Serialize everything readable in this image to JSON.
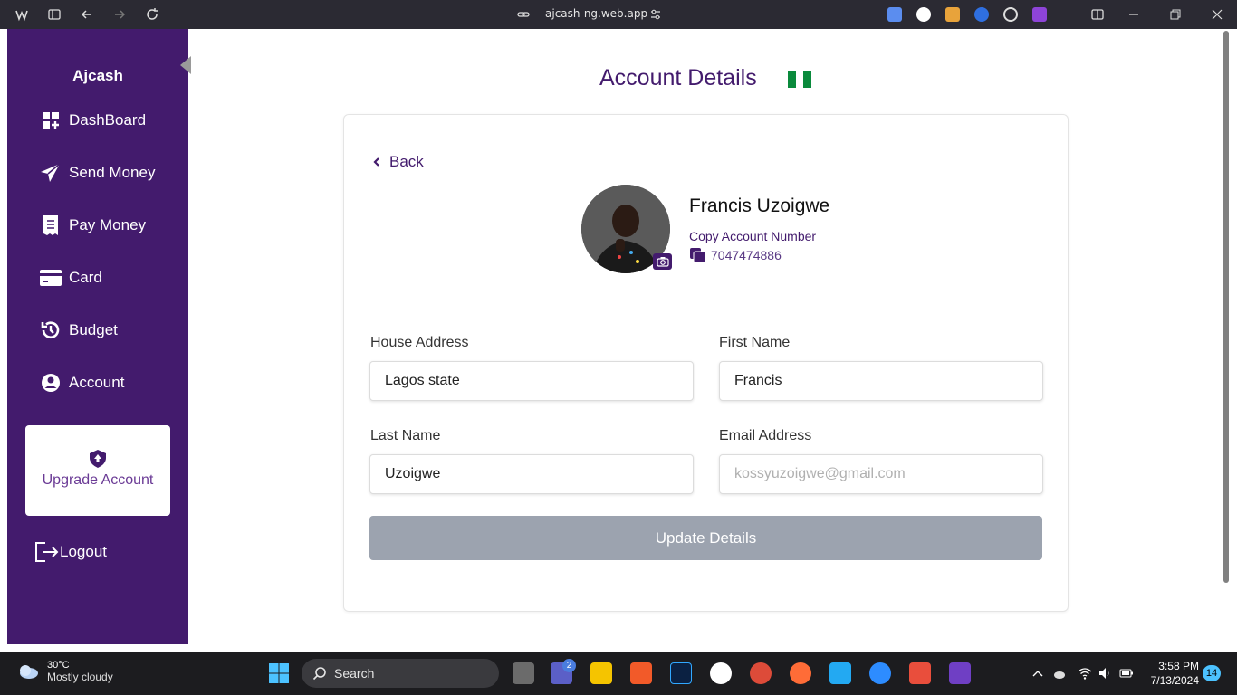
{
  "browser": {
    "url": "ajcash-ng.web.app"
  },
  "sidebar": {
    "brand": "Ajcash",
    "items": [
      {
        "label": "DashBoard",
        "icon": "dashboard-icon"
      },
      {
        "label": "Send Money",
        "icon": "paper-plane-icon"
      },
      {
        "label": "Pay Money",
        "icon": "receipt-icon"
      },
      {
        "label": "Card",
        "icon": "credit-card-icon"
      },
      {
        "label": "Budget",
        "icon": "history-icon"
      },
      {
        "label": "Account",
        "icon": "user-circle-icon"
      }
    ],
    "upgrade_label": "Upgrade Account",
    "logout_label": "Logout"
  },
  "main": {
    "title": "Account Details",
    "back_label": "Back",
    "profile": {
      "name": "Francis Uzoigwe",
      "copy_label": "Copy Account Number",
      "account_number": "7047474886"
    },
    "form": {
      "house_address_label": "House Address",
      "house_address_value": "Lagos state",
      "first_name_label": "First Name",
      "first_name_value": "Francis",
      "last_name_label": "Last Name",
      "last_name_value": "Uzoigwe",
      "email_label": "Email Address",
      "email_placeholder": "kossyuzoigwe@gmail.com",
      "submit_label": "Update Details"
    }
  },
  "taskbar": {
    "temperature": "30°C",
    "weather": "Mostly cloudy",
    "search_label": "Search",
    "teams_badge": "2",
    "time": "3:58 PM",
    "date": "7/13/2024",
    "notifications": "14"
  },
  "colors": {
    "primary": "#431b6d",
    "button_disabled": "#9ca3af"
  }
}
